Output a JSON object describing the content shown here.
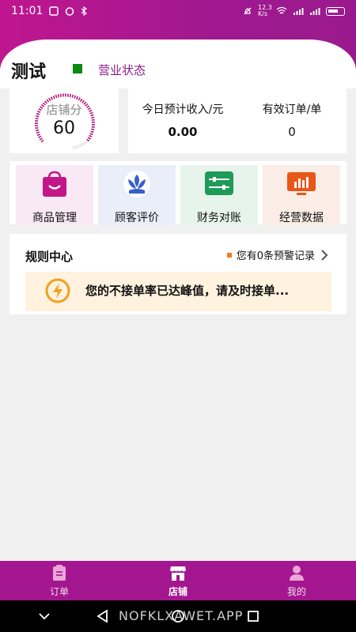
{
  "status_bar": {
    "time": "11:01",
    "network_speed": "12.3 K/s"
  },
  "header": {
    "shop_name": "测试",
    "status_label": "营业状态",
    "status_color": "#0a8a10"
  },
  "score": {
    "label": "店铺分",
    "value": "60"
  },
  "stats": [
    {
      "label": "今日预计收入/元",
      "value": "0.00"
    },
    {
      "label": "有效订单/单",
      "value": "0"
    }
  ],
  "menu": [
    {
      "label": "商品管理",
      "icon": "shopping-bag-icon"
    },
    {
      "label": "顾客评价",
      "icon": "tulip-icon"
    },
    {
      "label": "财务对账",
      "icon": "ledger-icon"
    },
    {
      "label": "经营数据",
      "icon": "bar-chart-icon"
    }
  ],
  "rules": {
    "title": "规则中心",
    "link_text": "您有0条预警记录",
    "alert_text": "您的不接单率已达峰值，请及时接单..."
  },
  "tabs": [
    {
      "label": "订单",
      "icon": "clipboard-icon"
    },
    {
      "label": "店铺",
      "icon": "store-icon"
    },
    {
      "label": "我的",
      "icon": "person-icon"
    }
  ],
  "watermark": "NOFKLXAWET.APP",
  "colors": {
    "brand": "#a4168f",
    "accent_orange": "#f07a20"
  }
}
